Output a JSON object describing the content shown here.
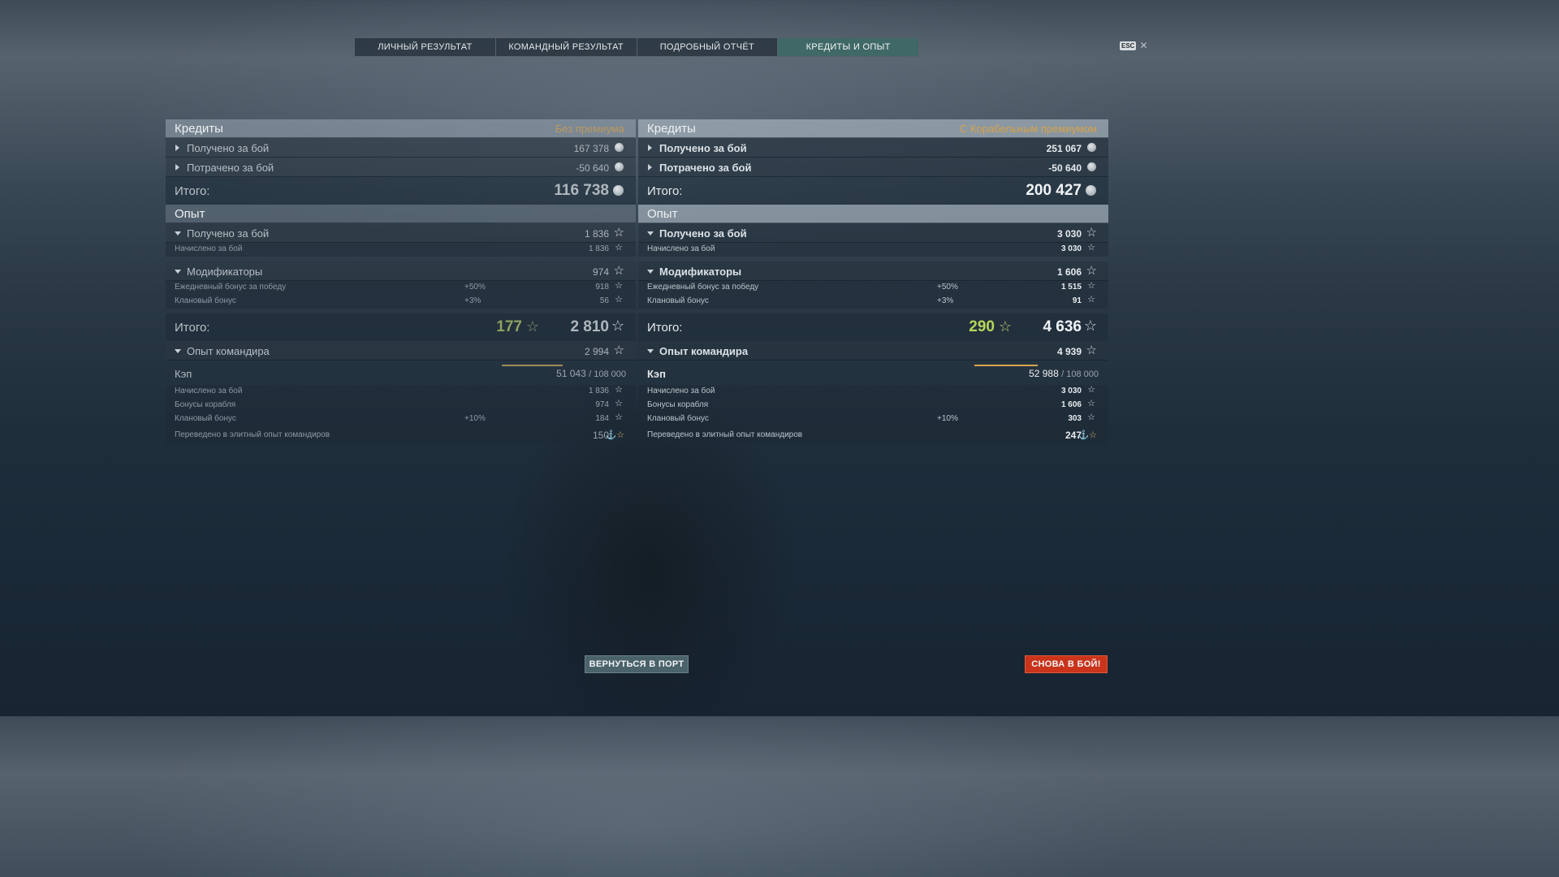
{
  "tabs": [
    {
      "label": "ЛИЧНЫЙ РЕЗУЛЬТАТ"
    },
    {
      "label": "КОМАНДНЫЙ РЕЗУЛЬТАТ"
    },
    {
      "label": "ПОДРОБНЫЙ ОТЧЁТ"
    },
    {
      "label": "КРЕДИТЫ И ОПЫТ",
      "active": true
    }
  ],
  "esc": {
    "key": "ESC",
    "close": "✕"
  },
  "left": {
    "credits_title": "Кредиты",
    "credits_subtitle": "Без премиума",
    "received_label": "Получено за бой",
    "received_value": "167 378",
    "spent_label": "Потрачено за бой",
    "spent_value": "-50 640",
    "credits_total_label": "Итого:",
    "credits_total_value": "116 738",
    "xp_title": "Опыт",
    "xp_received_label": "Получено за бой",
    "xp_received_value": "1 836",
    "xp_accrued_label": "Начислено за бой",
    "xp_accrued_value": "1 836",
    "modifiers_label": "Модификаторы",
    "modifiers_value": "974",
    "daily_bonus_label": "Ежедневный бонус за победу",
    "daily_bonus_pct": "+50%",
    "daily_bonus_value": "918",
    "clan_bonus_label": "Клановый бонус",
    "clan_bonus_pct": "+3%",
    "clan_bonus_value": "56",
    "xp_total_label": "Итого:",
    "xp_total_free": "177",
    "xp_total_value": "2 810",
    "commander_label": "Опыт командира",
    "commander_value": "2 994",
    "kap_label": "Кэп",
    "kap_value": "51 043",
    "kap_max": "/ 108 000",
    "kap_progress": 0.47,
    "cmd_accrued_label": "Начислено за бой",
    "cmd_accrued_value": "1 836",
    "ship_bonus_label": "Бонусы корабля",
    "ship_bonus_value": "974",
    "cmd_clan_label": "Клановый бонус",
    "cmd_clan_pct": "+10%",
    "cmd_clan_value": "184",
    "elite_label": "Переведено в элитный опыт командиров",
    "elite_value": "150"
  },
  "right": {
    "credits_title": "Кредиты",
    "credits_subtitle": "С Корабельным премиумом",
    "received_label": "Получено за бой",
    "received_value": "251 067",
    "spent_label": "Потрачено за бой",
    "spent_value": "-50 640",
    "credits_total_label": "Итого:",
    "credits_total_value": "200 427",
    "xp_title": "Опыт",
    "xp_received_label": "Получено за бой",
    "xp_received_value": "3 030",
    "xp_accrued_label": "Начислено за бой",
    "xp_accrued_value": "3 030",
    "modifiers_label": "Модификаторы",
    "modifiers_value": "1 606",
    "daily_bonus_label": "Ежедневный бонус за победу",
    "daily_bonus_pct": "+50%",
    "daily_bonus_value": "1 515",
    "clan_bonus_label": "Клановый бонус",
    "clan_bonus_pct": "+3%",
    "clan_bonus_value": "91",
    "xp_total_label": "Итого:",
    "xp_total_free": "290",
    "xp_total_value": "4 636",
    "commander_label": "Опыт командира",
    "commander_value": "4 939",
    "kap_label": "Кэп",
    "kap_value": "52 988",
    "kap_max": "/ 108 000",
    "kap_progress": 0.49,
    "cmd_accrued_label": "Начислено за бой",
    "cmd_accrued_value": "3 030",
    "ship_bonus_label": "Бонусы корабля",
    "ship_bonus_value": "1 606",
    "cmd_clan_label": "Клановый бонус",
    "cmd_clan_pct": "+10%",
    "cmd_clan_value": "303",
    "elite_label": "Переведено в элитный опыт командиров",
    "elite_value": "247"
  },
  "buttons": {
    "port": "ВЕРНУТЬСЯ В ПОРТ",
    "battle": "СНОВА В БОЙ!"
  },
  "icons": {
    "credit": "credit-coin-icon",
    "xp": "star-icon",
    "elite": "elite-xp-icon"
  },
  "colors": {
    "active_tab": "#3f6866",
    "premium_gold": "#d6a24a",
    "free_xp_green": "#b7d658",
    "battle_button": "#c9341a",
    "port_button": "#4a6269"
  }
}
